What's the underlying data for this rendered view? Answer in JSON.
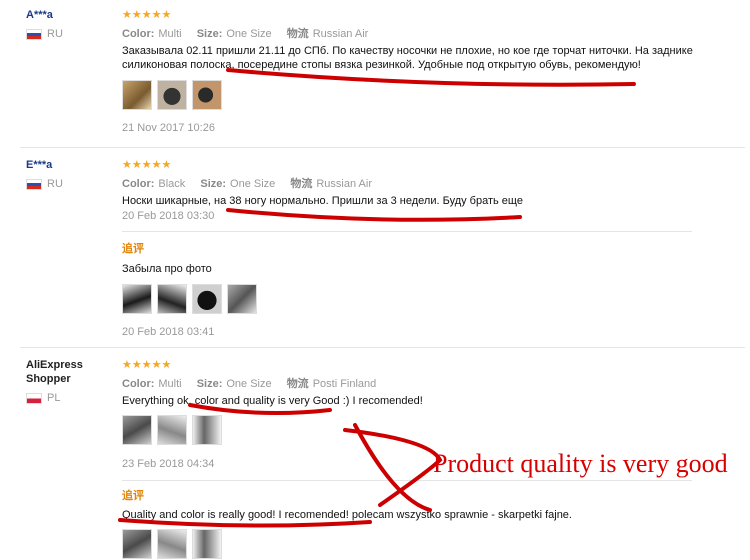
{
  "colors": {
    "username": "#1a3a8a",
    "stars": "#f5a623",
    "muted": "#999999",
    "additional": "#e0840a",
    "annotation": "#cc0000"
  },
  "labels": {
    "color": "Color:",
    "size": "Size:",
    "shipping": "物流",
    "additional_review": "追评",
    "stars": "★★★★★"
  },
  "reviews": [
    {
      "user": "A***a",
      "country": "RU",
      "rating": 5,
      "color": "Multi",
      "size": "One Size",
      "shipping": "Russian Air",
      "text": "Заказывала 02.11 пришли 21.11 до СПб. По качеству носочки не плохие, но кое где торчат ниточки. На заднике силиконовая полоска, посередине стопы вязка резинкой. Удобные под открытую обувь, рекомендую!",
      "thumb_count": 3,
      "date": "21 Nov 2017 10:26"
    },
    {
      "user": "E***a",
      "country": "RU",
      "rating": 5,
      "color": "Black",
      "size": "One Size",
      "shipping": "Russian Air",
      "text": "Носки шикарные, на 38 ногу нормально. Пришли за 3 недели. Буду брать еще",
      "date": "20 Feb 2018 03:30",
      "additional": {
        "text": "Забыла про фото",
        "thumb_count": 4,
        "date": "20 Feb 2018 03:41"
      }
    },
    {
      "user": "AliExpress Shopper",
      "country": "PL",
      "rating": 5,
      "color": "Multi",
      "size": "One Size",
      "shipping": "Posti Finland",
      "text": "Everything ok. color and quality is very Good :) I recomended!",
      "thumb_count": 3,
      "date": "23 Feb 2018 04:34",
      "additional": {
        "text": "Quality and color is really good! I recomended! polecam wszystko sprawnie - skarpetki fajne.",
        "thumb_count": 3
      }
    }
  ],
  "annotation": {
    "text": "Product quality is very good"
  }
}
